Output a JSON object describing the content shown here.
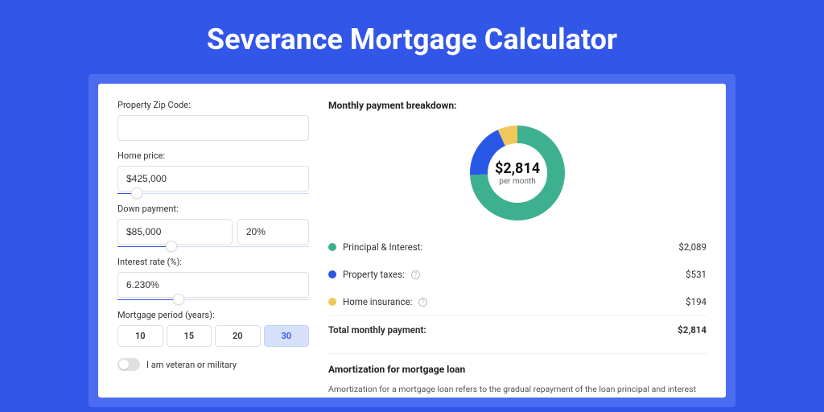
{
  "title": "Severance Mortgage Calculator",
  "form": {
    "zip_label": "Property Zip Code:",
    "zip_value": "",
    "home_price_label": "Home price:",
    "home_price_value": "$425,000",
    "home_price_pct": 10,
    "down_payment_label": "Down payment:",
    "down_payment_value": "$85,000",
    "down_payment_pct_value": "20%",
    "down_payment_slider_pct": 28,
    "interest_label": "Interest rate (%):",
    "interest_value": "6.230%",
    "interest_slider_pct": 32,
    "period_label": "Mortgage period (years):",
    "period_options": [
      "10",
      "15",
      "20",
      "30"
    ],
    "period_selected": 3,
    "veteran_label": "I am veteran or military",
    "veteran_on": false
  },
  "breakdown": {
    "title": "Monthly payment breakdown:",
    "center_amount": "$2,814",
    "center_sub": "per month",
    "items": [
      {
        "label": "Principal & Interest:",
        "colorClass": "green",
        "amount": "$2,089",
        "help": false
      },
      {
        "label": "Property taxes:",
        "colorClass": "blue",
        "amount": "$531",
        "help": true
      },
      {
        "label": "Home insurance:",
        "colorClass": "yellow",
        "amount": "$194",
        "help": true
      }
    ],
    "total_label": "Total monthly payment:",
    "total_amount": "$2,814"
  },
  "chart_data": {
    "type": "pie",
    "title": "Monthly payment breakdown",
    "series": [
      {
        "name": "Principal & Interest",
        "value": 2089,
        "color": "#3db08f"
      },
      {
        "name": "Property taxes",
        "value": 531,
        "color": "#2958e6"
      },
      {
        "name": "Home insurance",
        "value": 194,
        "color": "#f0c859"
      }
    ],
    "total": 2814,
    "center_label": "$2,814 per month"
  },
  "amortization": {
    "title": "Amortization for mortgage loan",
    "text": "Amortization for a mortgage loan refers to the gradual repayment of the loan principal and interest over a specified"
  }
}
